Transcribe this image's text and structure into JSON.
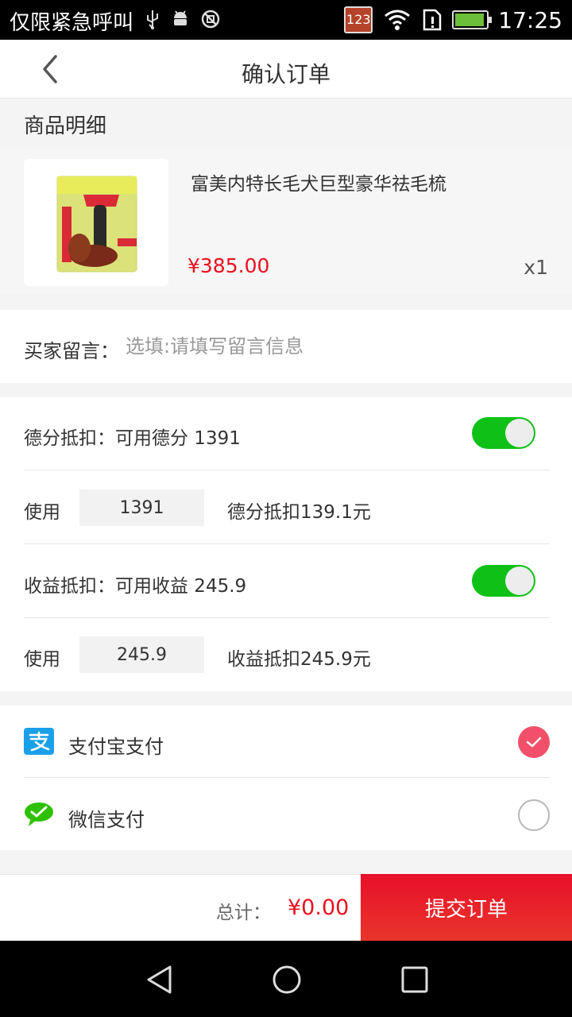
{
  "status_bar": {
    "carrier_text": "仅限紧急呼叫",
    "badge": "123",
    "time": "17:25",
    "icons": [
      "usb-icon",
      "android-icon",
      "no-sim-icon",
      "wifi-icon",
      "sim-alert-icon",
      "battery-charging-icon"
    ]
  },
  "header": {
    "title": "确认订单",
    "back_icon": "chevron-left-icon"
  },
  "product_section": {
    "title": "商品明细",
    "item": {
      "name": "富美内特长毛犬巨型豪华祛毛梳",
      "price": "¥385.00",
      "quantity": "x1"
    }
  },
  "message": {
    "label": "买家留言：",
    "placeholder": "选填:请填写留言信息",
    "value": ""
  },
  "deductions": {
    "points": {
      "label": "德分抵扣：可用德分 1391",
      "enabled": true,
      "use_label": "使用",
      "use_value": "1391",
      "note": "德分抵扣139.1元"
    },
    "earnings": {
      "label": "收益抵扣：可用收益 245.9",
      "enabled": true,
      "use_label": "使用",
      "use_value": "245.9",
      "note": "收益抵扣245.9元"
    }
  },
  "payment": {
    "options": [
      {
        "label": "支付宝支付",
        "icon": "alipay-icon",
        "selected": true
      },
      {
        "label": "微信支付",
        "icon": "wechat-icon",
        "selected": false
      }
    ]
  },
  "footer": {
    "total_label": "总计：",
    "total_value": "¥0.00",
    "submit_label": "提交订单"
  },
  "colors": {
    "accent_red": "#e8101e",
    "toggle_green": "#0fc116",
    "radio_pink": "#f2506a",
    "alipay_blue": "#1aa0e8",
    "wechat_green": "#2dc100"
  }
}
